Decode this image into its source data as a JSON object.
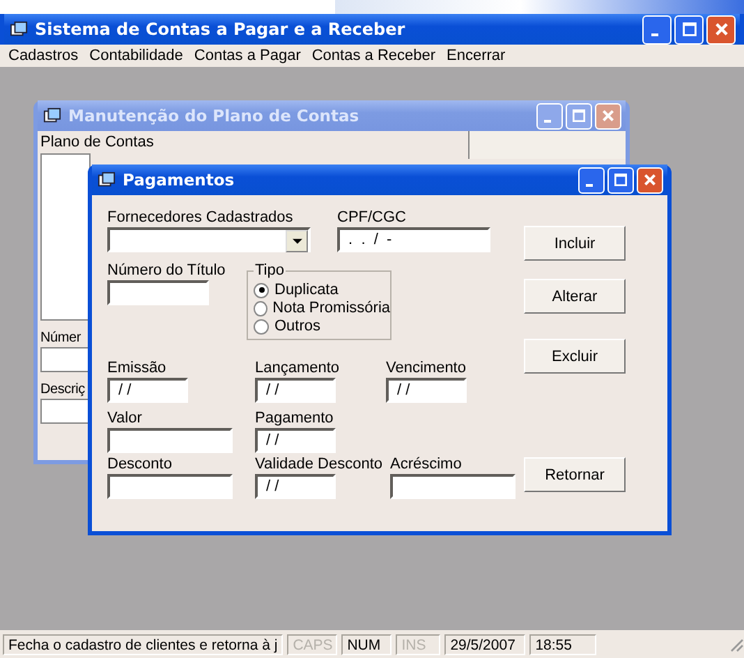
{
  "main_window": {
    "title": "Sistema de Contas a Pagar e a Receber",
    "active": true,
    "menu": [
      "Cadastros",
      "Contabilidade",
      "Contas a Pagar",
      "Contas a Receber",
      "Encerrar"
    ]
  },
  "child_window": {
    "title": "Manutenção do Plano de Contas",
    "active": false,
    "list_label": "Plano de Contas",
    "labels": [
      "Númer",
      "Descriç"
    ]
  },
  "dialog": {
    "title": "Pagamentos",
    "active": true,
    "rows": [
      [
        {
          "kind": "combo",
          "label": "Fornecedores Cadastrados"
        },
        {
          "kind": "text",
          "label": "CPF/CGC",
          "value": " .  .  /  -"
        }
      ],
      [
        {
          "kind": "text",
          "label": "Número do Título"
        },
        {
          "kind": "radio_group",
          "label": "Tipo",
          "options": [
            {
              "label": "Duplicata",
              "selected": true
            },
            {
              "label": "Nota Promissória",
              "selected": false
            },
            {
              "label": "Outros",
              "selected": false
            }
          ]
        }
      ],
      [
        {
          "kind": "text",
          "label": "Emissão",
          "value": " / /"
        },
        {
          "kind": "text",
          "label": "Lançamento",
          "value": " / /"
        },
        {
          "kind": "text",
          "label": "Vencimento",
          "value": " / /"
        }
      ],
      [
        {
          "kind": "text",
          "label": "Valor"
        },
        {
          "kind": "text",
          "label": "Pagamento",
          "value": " / /"
        }
      ],
      [
        {
          "kind": "text",
          "label": "Desconto"
        },
        {
          "kind": "text",
          "label": "Validade Desconto",
          "value": " / /"
        },
        {
          "kind": "text",
          "label": "Acréscimo"
        }
      ]
    ],
    "buttons": [
      "Incluir",
      "Alterar",
      "Excluir",
      "Retornar"
    ]
  },
  "status_bar": [
    {
      "text": "Fecha o cadastro de clientes e retorna à j",
      "disabled": false
    },
    {
      "text": "CAPS",
      "disabled": true
    },
    {
      "text": "NUM",
      "disabled": false
    },
    {
      "text": "INS",
      "disabled": true
    },
    {
      "text": "29/5/2007",
      "disabled": false
    },
    {
      "text": "18:55",
      "disabled": false
    }
  ]
}
